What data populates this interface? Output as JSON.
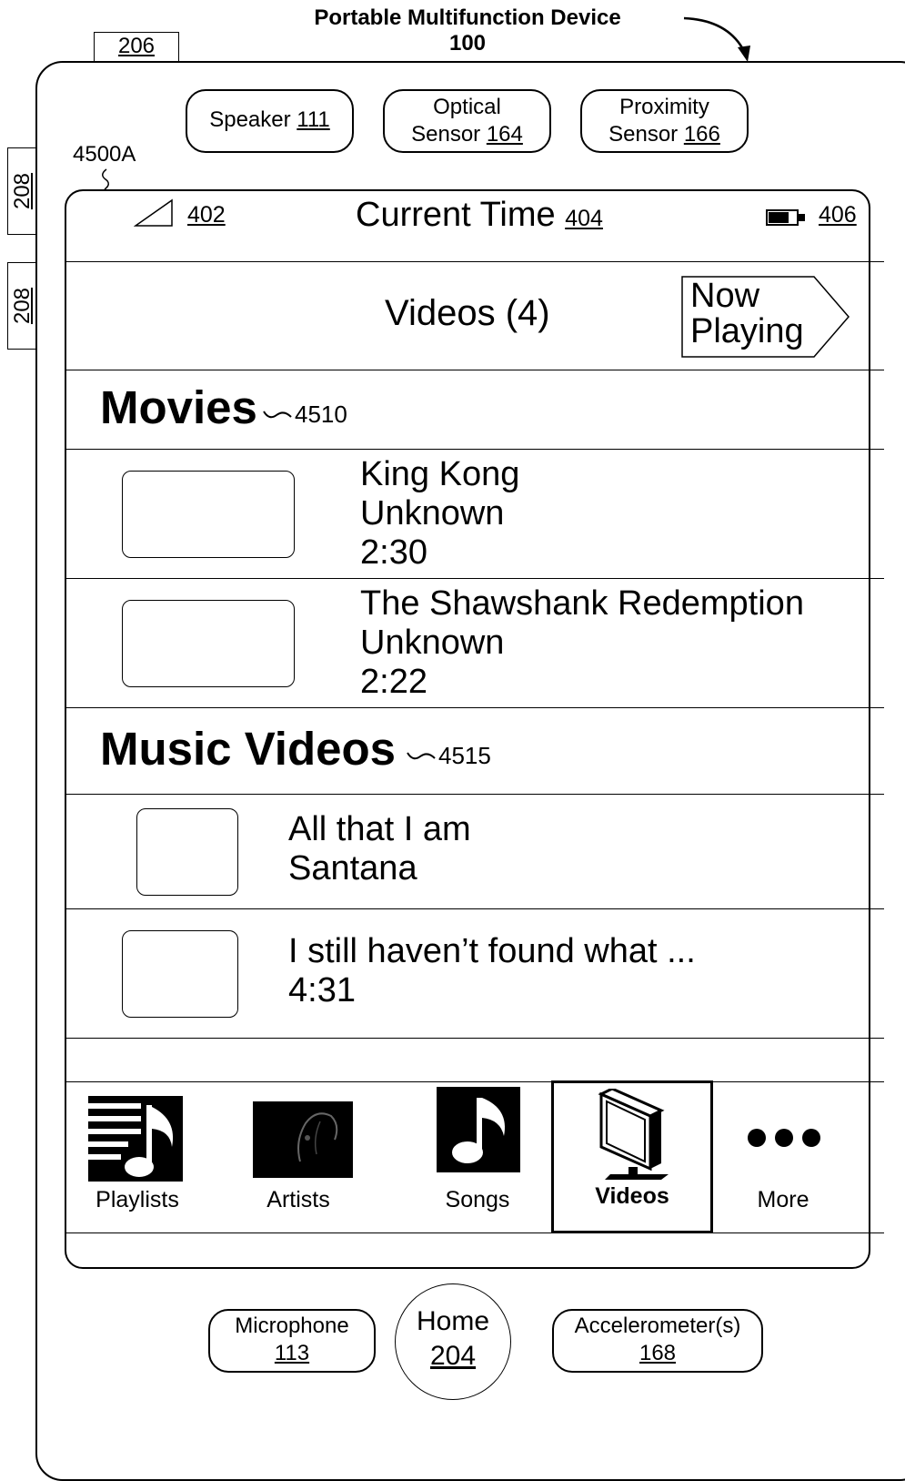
{
  "device": {
    "title_line1": "Portable Multifunction Device",
    "title_line2": "100",
    "ref_206": "206",
    "ref_208_a": "208",
    "ref_208_b": "208",
    "screen_ref": "4500A"
  },
  "sensors": {
    "speaker": {
      "label": "Speaker",
      "ref": "111"
    },
    "optical": {
      "line1": "Optical",
      "label": "Sensor",
      "ref": "164"
    },
    "proximity": {
      "line1": "Proximity",
      "label": "Sensor",
      "ref": "166"
    }
  },
  "status_bar": {
    "signal_ref": "402",
    "time_label": "Current Time",
    "time_ref": "404",
    "battery_ref": "406"
  },
  "nav": {
    "title": "Videos (4)",
    "now_playing_line1": "Now",
    "now_playing_line2": "Playing"
  },
  "sections": {
    "movies": {
      "title": "Movies",
      "ref": "4510"
    },
    "music_videos": {
      "title": "Music Videos",
      "ref": "4515"
    }
  },
  "movies": [
    {
      "title": "King Kong",
      "artist": "Unknown",
      "duration": "2:30"
    },
    {
      "title": "The Shawshank Redemption",
      "artist": "Unknown",
      "duration": "2:22"
    }
  ],
  "music_videos": [
    {
      "line1": "All that I am",
      "line2": "Santana"
    },
    {
      "line1": "I still haven’t found what ...",
      "line2": "4:31"
    }
  ],
  "tabs": {
    "playlists": "Playlists",
    "artists": "Artists",
    "songs": "Songs",
    "videos": "Videos",
    "more": "More",
    "selected": "Videos"
  },
  "hardware": {
    "microphone": {
      "label": "Microphone",
      "ref": "113"
    },
    "home": {
      "label": "Home",
      "ref": "204"
    },
    "accelerometer": {
      "label": "Accelerometer(s)",
      "ref": "168"
    }
  }
}
